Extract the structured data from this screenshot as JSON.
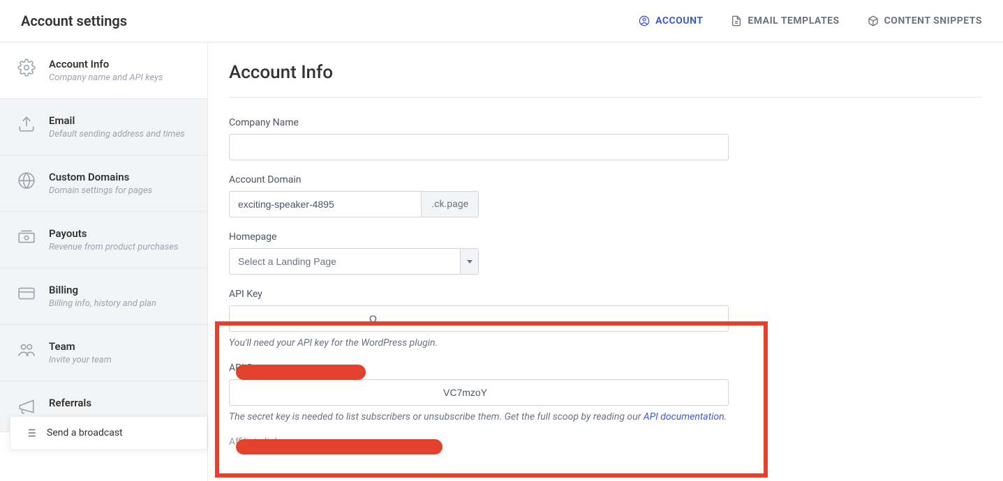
{
  "header": {
    "title": "Account settings",
    "nav": [
      {
        "label": "ACCOUNT",
        "active": true
      },
      {
        "label": "EMAIL TEMPLATES",
        "active": false
      },
      {
        "label": "CONTENT SNIPPETS",
        "active": false
      }
    ]
  },
  "sidebar": {
    "items": [
      {
        "title": "Account Info",
        "sub": "Company name and API keys",
        "active": true
      },
      {
        "title": "Email",
        "sub": "Default sending address and times",
        "active": false
      },
      {
        "title": "Custom Domains",
        "sub": "Domain settings for pages",
        "active": false
      },
      {
        "title": "Payouts",
        "sub": "Revenue from product purchases",
        "active": false
      },
      {
        "title": "Billing",
        "sub": "Billing info, history and plan",
        "active": false
      },
      {
        "title": "Team",
        "sub": "Invite your team",
        "active": false
      },
      {
        "title": "Referrals",
        "sub": "",
        "active": false
      }
    ]
  },
  "main": {
    "heading": "Account Info",
    "company_name_label": "Company Name",
    "company_name_value": "",
    "account_domain_label": "Account Domain",
    "account_domain_value": "exciting-speaker-4895",
    "account_domain_suffix": ".ck.page",
    "homepage_label": "Homepage",
    "homepage_placeholder": "Select a Landing Page",
    "api_key_label": "API Key",
    "api_key_value_suffix": "Q",
    "api_key_help": "You'll need your API key for the WordPress plugin.",
    "api_secret_label": "API Secret",
    "api_secret_value_suffix": "VC7mzoY",
    "api_secret_help_prefix": "The secret key is needed to list subscribers or unsubscribe them. Get the full scoop by reading our ",
    "api_secret_help_link": "API documentation.",
    "affiliate_label": "Affiliate link"
  },
  "broadcast_button": "Send a broadcast"
}
